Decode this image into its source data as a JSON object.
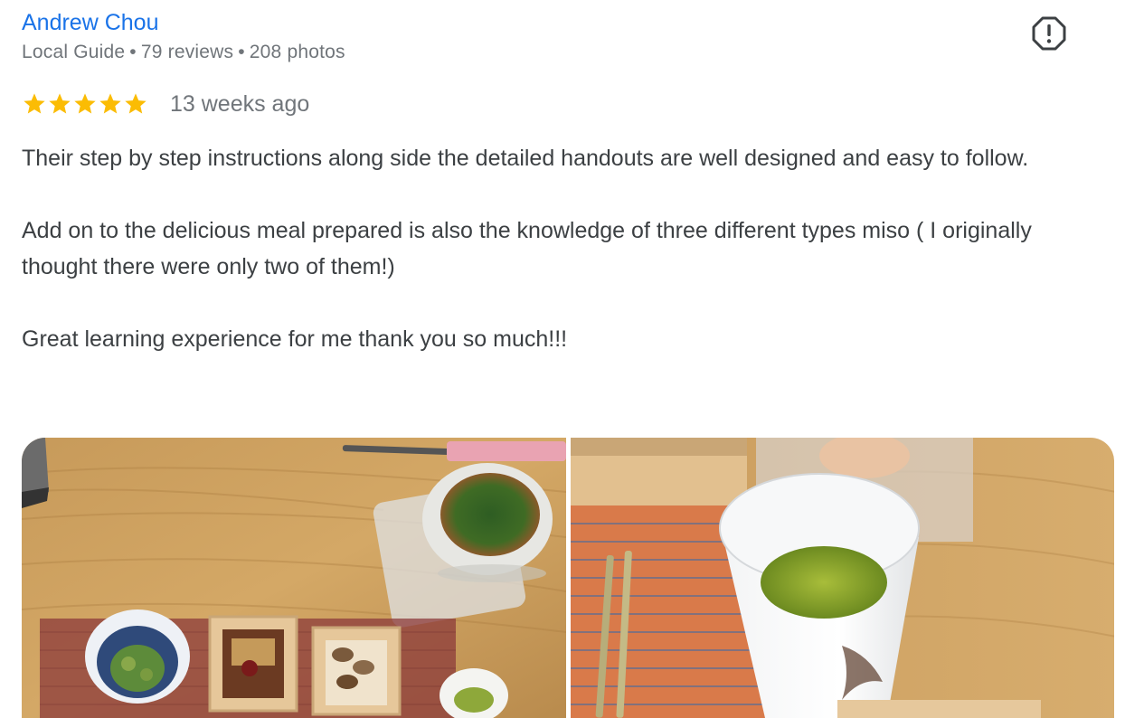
{
  "review": {
    "author": {
      "name": "Andrew Chou",
      "badge": "Local Guide",
      "reviews": "79 reviews",
      "photos": "208 photos",
      "separator": "•"
    },
    "rating": {
      "stars": 5,
      "max": 5,
      "color": "#fbbc04"
    },
    "date": "13 weeks ago",
    "paragraphs": [
      "Their step by step instructions along side the detailed handouts are well designed and easy to follow.",
      "Add on to the delicious meal prepared is also the knowledge of three different types miso ( I originally thought there were only two of them!)",
      "Great learning experience for me thank you so much!!!"
    ],
    "flag_icon": "report-flag-icon",
    "photo_count": 2
  },
  "colors": {
    "author_link": "#1a73e8",
    "meta_text": "#70757a",
    "body_text": "#3c4043",
    "star": "#fbbc04"
  }
}
